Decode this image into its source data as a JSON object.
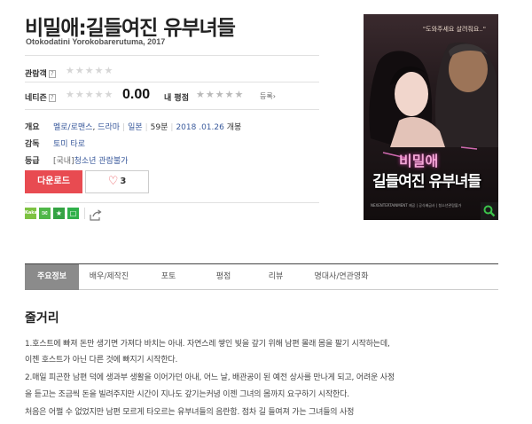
{
  "movie": {
    "title": "비밀애:길들여진 유부녀들",
    "original_title": "Otokodatini Yorokobarerutuma, 2017"
  },
  "ratings": {
    "audience_label": "관람객",
    "netizen_label": "네티즌",
    "help_glyph": "?",
    "score": "0.00",
    "my_rating_label": "내 평점",
    "register_label": "등록"
  },
  "info": {
    "overview_label": "개요",
    "genres": [
      "멜로/로맨스",
      "드라마"
    ],
    "country": "일본",
    "runtime": "59분",
    "release_date": "2018 .01.26",
    "release_suffix": "개봉",
    "director_label": "감독",
    "director": "토미 타로",
    "grade_label": "등급",
    "grade_prefix": "[국내]",
    "grade": "청소년 관람불가"
  },
  "actions": {
    "download_label": "다운로드",
    "like_count": "3"
  },
  "share": {
    "kakao_text": "Kakao"
  },
  "poster": {
    "quote": "\"도와주세요 살려줘요..\"",
    "title_line1": "비밀애",
    "title_line2": "길들여진 유부녀들",
    "footer": "NEXENTERTAINMENT 제공 | 공식배급사 | 청소년관람불가"
  },
  "tabs": [
    "주요정보",
    "배우/제작진",
    "포토",
    "평점",
    "리뷰",
    "명대사/연관영화"
  ],
  "active_tab": "주요정보",
  "synopsis": {
    "title": "줄거리",
    "lines": [
      "1.호스트에 빠져 돈만 생기면 가져다 바치는 아내. 자연스레 쌓인 빚을 갚기 위해 남편 몰래 몸을 팔기 시작하는데,",
      "이젠 호스트가 아닌 다른 것에 빠지기 시작한다.",
      " 2.매일 피곤한 남편 덕에 생과부 생활을 이어가던 아내, 어느 날, 배관공이 된 예전 상사를 만나게 되고, 어려운 사정",
      "을 듣고는 조금씩 돈을 빌려주지만 시간이 지나도 갚기는커녕 이젠 그녀의 몸까지 요구하기 시작한다.",
      "  처음은 어쩔 수 없었지만 남편 모르게 타오르는 유부녀들의 음란함. 점차 길 들여져 가는 그녀들의 사정"
    ]
  },
  "colors": {
    "accent_red": "#e84b51",
    "link_blue": "#3a5a9c",
    "active_tab_bg": "#8b8b8b"
  },
  "icons": {
    "like": "heart-icon",
    "share": "share-icon",
    "arrow": "chevron-right-icon",
    "search": "search-icon"
  }
}
